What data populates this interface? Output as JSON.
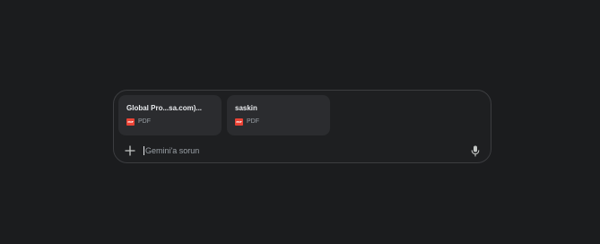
{
  "composer": {
    "attachments": [
      {
        "title": "Global Pro...sa.com)...",
        "icon_label": "PDF",
        "type": "PDF"
      },
      {
        "title": "saskin",
        "icon_label": "PDF",
        "type": "PDF"
      }
    ],
    "add_icon": "plus-icon",
    "prompt_placeholder": "Gemini'a sorun",
    "prompt_value": "",
    "mic_icon": "microphone-icon"
  },
  "colors": {
    "background": "#1b1c1e",
    "composer_border": "#3c3d40",
    "chip_background": "#2b2c2f",
    "pdf_red": "#ea4335",
    "text_primary": "#e8eaed",
    "text_secondary": "#9aa0a6"
  }
}
